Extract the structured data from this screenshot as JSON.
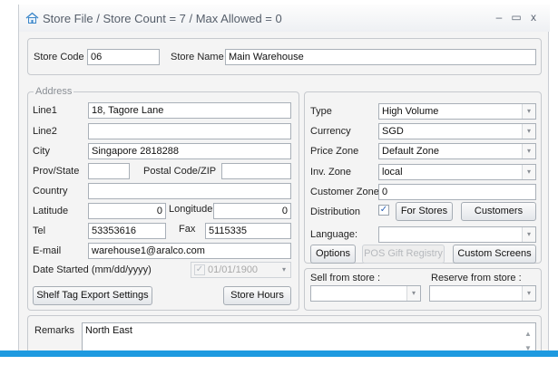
{
  "window": {
    "title": "Store File / Store Count = 7 / Max Allowed = 0",
    "minimize_glyph": "–",
    "maximize_glyph": "▭",
    "close_glyph": "x"
  },
  "store": {
    "code_label": "Store Code",
    "code_value": "06",
    "name_label": "Store Name",
    "name_value": "Main Warehouse"
  },
  "address": {
    "legend": "Address",
    "line1_label": "Line1",
    "line1_value": "18, Tagore Lane",
    "line2_label": "Line2",
    "line2_value": "",
    "city_label": "City",
    "city_value": "Singapore 2818288",
    "prov_label": "Prov/State",
    "prov_value": "",
    "postal_label": "Postal Code/ZIP",
    "postal_value": "",
    "country_label": "Country",
    "country_value": "",
    "latitude_label": "Latitude",
    "latitude_value": "0",
    "longitude_label": "Longitude",
    "longitude_value": "0",
    "tel_label": "Tel",
    "tel_value": "53353616",
    "fax_label": "Fax",
    "fax_value": "5115335",
    "email_label": "E-mail",
    "email_value": "warehouse1@aralco.com",
    "date_label": "Date Started (mm/dd/yyyy)",
    "date_value": "01/01/1900",
    "shelf_tag_button": "Shelf Tag Export Settings",
    "store_hours_button": "Store Hours"
  },
  "settings": {
    "type_label": "Type",
    "type_value": "High Volume",
    "currency_label": "Currency",
    "currency_value": "SGD",
    "price_zone_label": "Price Zone",
    "price_zone_value": "Default Zone",
    "inv_zone_label": "Inv. Zone",
    "inv_zone_value": "local",
    "customer_zone_label": "Customer Zone",
    "customer_zone_value": "0",
    "distribution_label": "Distribution",
    "distribution_checked": true,
    "for_stores_button": "For Stores",
    "customers_button": "Customers",
    "language_label": "Language:",
    "language_value": "",
    "options_button": "Options",
    "pos_gift_button": "POS Gift Registry",
    "custom_screens_button": "Custom Screens"
  },
  "store_links": {
    "sell_from_label": "Sell from store :",
    "sell_from_value": "",
    "reserve_from_label": "Reserve from store :",
    "reserve_from_value": ""
  },
  "remarks": {
    "label": "Remarks",
    "value": "North East"
  },
  "colors": {
    "accent_bar": "#1e9ae0",
    "window_bg": "#f4f4f4"
  }
}
